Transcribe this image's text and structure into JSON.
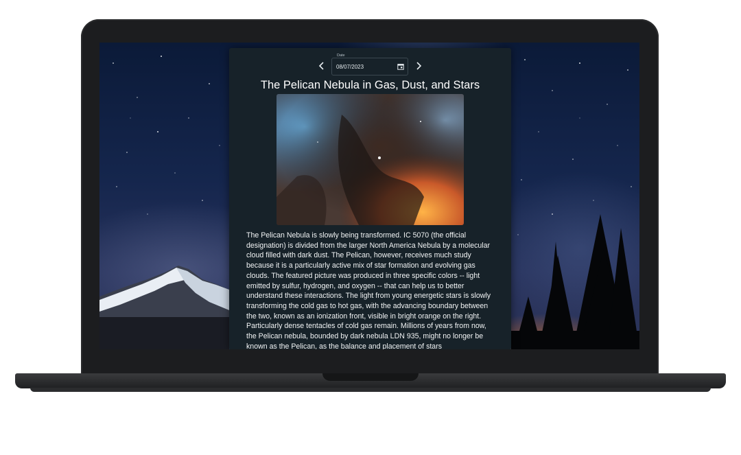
{
  "apod": {
    "date_label": "Date",
    "date_value": "08/07/2023",
    "title": "The Pelican Nebula in Gas, Dust, and Stars",
    "explanation": "The Pelican Nebula is slowly being transformed. IC 5070 (the official designation) is divided from the larger North America Nebula by a molecular cloud filled with dark dust. The Pelican, however, receives much study because it is a particularly active mix of star formation and evolving gas clouds. The featured picture was produced in three specific colors -- light emitted by sulfur, hydrogen, and oxygen -- that can help us to better understand these interactions. The light from young energetic stars is slowly transforming the cold gas to hot gas, with the advancing boundary between the two, known as an ionization front, visible in bright orange on the right. Particularly dense tentacles of cold gas remain. Millions of years from now, the Pelican nebula, bounded by dark nebula LDN 935, might no longer be known as the Pelican, as the balance and placement of stars"
  },
  "icons": {
    "prev": "chevron-left-icon",
    "next": "chevron-right-icon",
    "calendar": "calendar-icon"
  },
  "colors": {
    "panel_bg": "#172229",
    "laptop_frame": "#1c1d1f",
    "text": "#f2f4f5"
  }
}
